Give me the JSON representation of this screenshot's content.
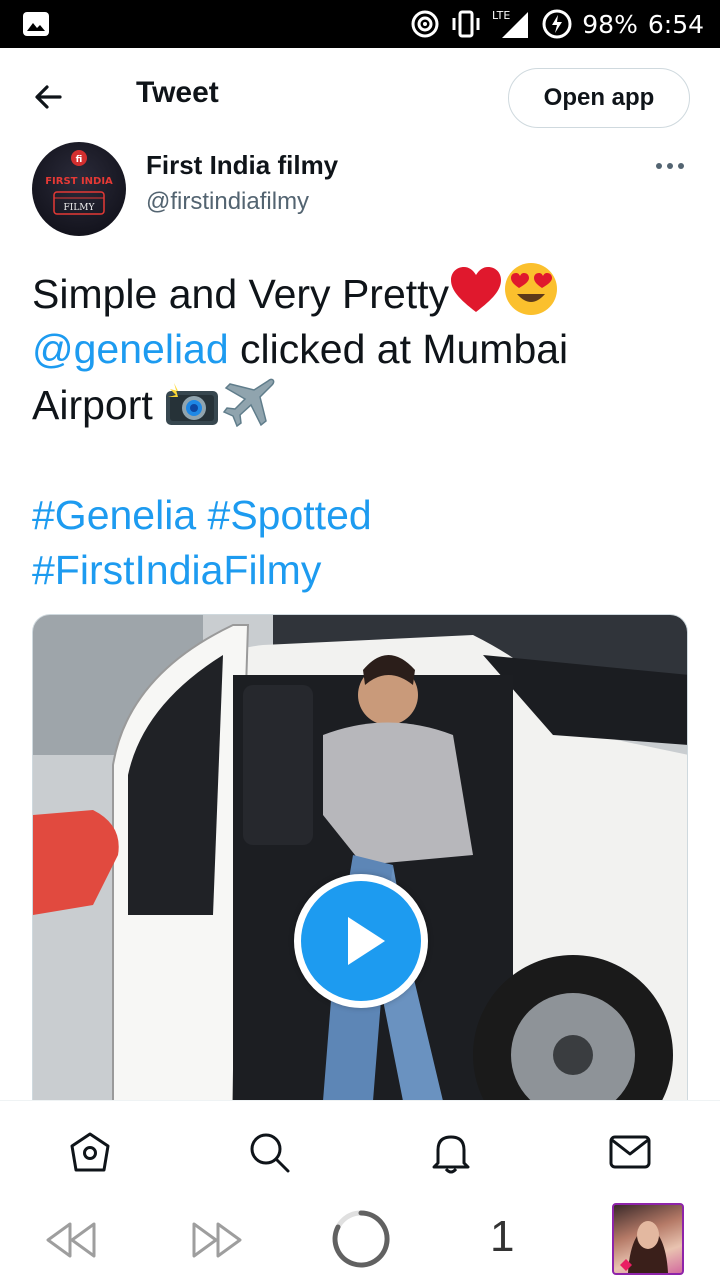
{
  "status_bar": {
    "battery": "98%",
    "time": "6:54",
    "network": "LTE"
  },
  "header": {
    "title": "Tweet",
    "open_app_label": "Open app"
  },
  "author": {
    "name": "First India filmy",
    "handle": "@firstindiafilmy",
    "avatar_text": "FIRST INDIA",
    "avatar_subtext": "FILMY"
  },
  "tweet": {
    "line1": "Simple and Very Pretty",
    "mention": "@geneliad",
    "line2_rest": " clicked at Mumbai",
    "line3": "Airport ",
    "hashtag1": "#Genelia",
    "hashtag2": "#Spotted",
    "hashtag3": "#FirstIndiaFilmy"
  },
  "browser": {
    "tab_count": "1"
  },
  "colors": {
    "accent": "#1d9bf0",
    "text": "#0f1419",
    "secondary": "#536471"
  }
}
